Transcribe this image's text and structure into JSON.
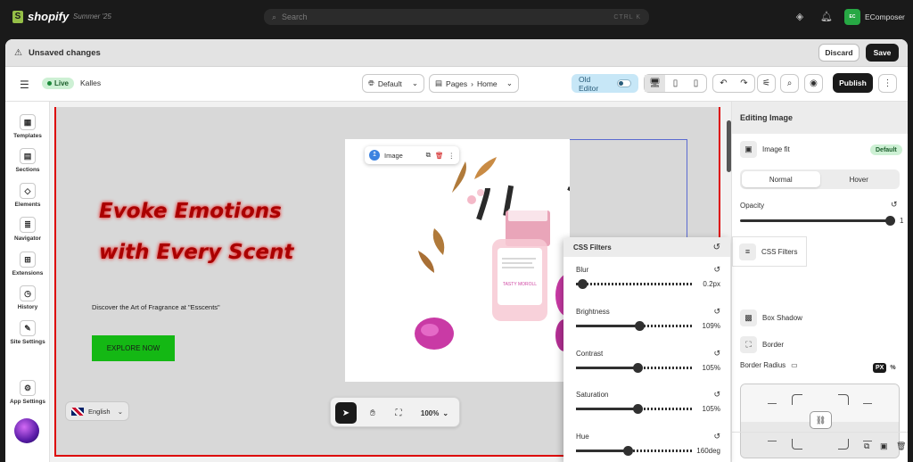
{
  "shopify": {
    "logo_text": "shopify",
    "edition": "Summer '25",
    "search_placeholder": "Search",
    "search_shortcut": "CTRL K",
    "store_avatar": "EC",
    "store_name": "EComposer"
  },
  "unsaved_bar": {
    "message": "Unsaved changes",
    "discard_label": "Discard",
    "save_label": "Save"
  },
  "toolbar": {
    "live_label": "Live",
    "theme_name": "Kalles",
    "device_select": "Default",
    "breadcrumb": [
      "Pages",
      "Home"
    ],
    "old_editor_label": "Old Editor",
    "publish_label": "Publish"
  },
  "sidebar": {
    "items": [
      {
        "label": "Templates",
        "icon": "templates-icon"
      },
      {
        "label": "Sections",
        "icon": "sections-icon"
      },
      {
        "label": "Elements",
        "icon": "elements-icon"
      },
      {
        "label": "Navigator",
        "icon": "navigator-icon"
      },
      {
        "label": "Extensions",
        "icon": "extensions-icon"
      },
      {
        "label": "History",
        "icon": "history-icon"
      },
      {
        "label": "Site Settings",
        "icon": "site-settings-icon"
      },
      {
        "label": "App Settings",
        "icon": "app-settings-icon"
      }
    ]
  },
  "canvas": {
    "hero_line1": "Evoke Emotions",
    "hero_line2": "with Every Scent",
    "subtitle": "Discover the Art of Fragrance at \"Esscents\"",
    "cta_label": "EXPLORE NOW",
    "language": "English",
    "image_toolbar_label": "Image",
    "bottle_label": "TASTY MOROLL",
    "zoom": "100%"
  },
  "css_filters": {
    "title": "CSS Filters",
    "rows": [
      {
        "label": "Blur",
        "value": "0.2px",
        "pct": 0.05
      },
      {
        "label": "Brightness",
        "value": "109%",
        "pct": 0.54
      },
      {
        "label": "Contrast",
        "value": "105%",
        "pct": 0.52
      },
      {
        "label": "Saturation",
        "value": "105%",
        "pct": 0.52
      },
      {
        "label": "Hue",
        "value": "160deg",
        "pct": 0.44
      }
    ]
  },
  "right_panel": {
    "title": "Editing Image",
    "image_fit_label": "Image fit",
    "image_fit_value": "Default",
    "tabs": [
      "Normal",
      "Hover"
    ],
    "opacity_label": "Opacity",
    "opacity_value": "1",
    "css_filters_label": "CSS Filters",
    "box_shadow_label": "Box Shadow",
    "border_label": "Border",
    "border_radius_label": "Border Radius",
    "unit_px": "PX",
    "unit_pct": "%"
  },
  "colors": {
    "brand_green": "#95bf47",
    "hero_red": "#aa0000",
    "cta_green": "#14b814",
    "live_badge_bg": "#cdf0d4"
  }
}
